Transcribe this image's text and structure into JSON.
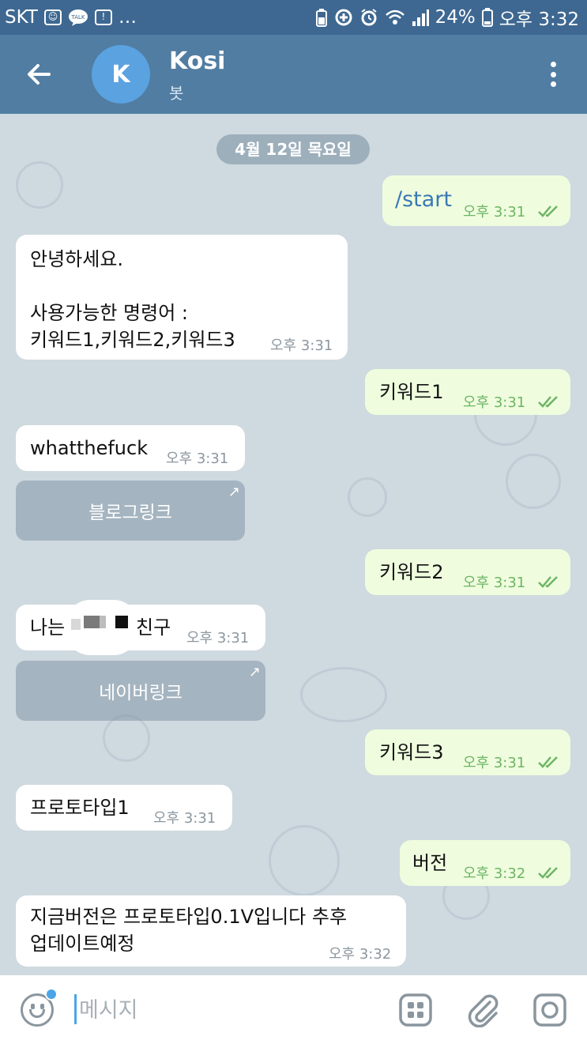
{
  "status_bar": {
    "carrier": "SKT",
    "battery": "24%",
    "time": "오후 3:32",
    "talk_badge": "TALK"
  },
  "header": {
    "avatar_letter": "K",
    "title": "Kosi",
    "subtitle": "봇"
  },
  "date_label": "4월 12일 목요일",
  "messages": [
    {
      "dir": "out",
      "text": "/start",
      "time": "오후 3:31"
    },
    {
      "dir": "in",
      "text": "안녕하세요.\n\n사용가능한 명령어 :\n키워드1,키워드2,키워드3",
      "time": "오후 3:31"
    },
    {
      "dir": "out",
      "text": "키워드1",
      "time": "오후 3:31"
    },
    {
      "dir": "in",
      "text": "whatthefuck",
      "time": "오후 3:31",
      "button": "블로그링크"
    },
    {
      "dir": "out",
      "text": "키워드2",
      "time": "오후 3:31"
    },
    {
      "dir": "in",
      "text_a": "나는",
      "text_b": "친구",
      "time": "오후 3:31",
      "button": "네이버링크"
    },
    {
      "dir": "out",
      "text": "키워드3",
      "time": "오후 3:31"
    },
    {
      "dir": "in",
      "text": "프로토타입1",
      "time": "오후 3:31"
    },
    {
      "dir": "out",
      "text": "버전",
      "time": "오후 3:32"
    },
    {
      "dir": "in",
      "text": "지금버전은 프로토타입0.1V입니다 추후\n업데이트예정",
      "time": "오후 3:32"
    }
  ],
  "input": {
    "placeholder": "메시지"
  },
  "colors": {
    "header": "#517da2",
    "status_bar": "#3e6891",
    "outgoing_bubble": "#effdde",
    "incoming_bubble": "#ffffff",
    "chat_background": "#cfd9e0",
    "accent": "#4aa5e8"
  }
}
